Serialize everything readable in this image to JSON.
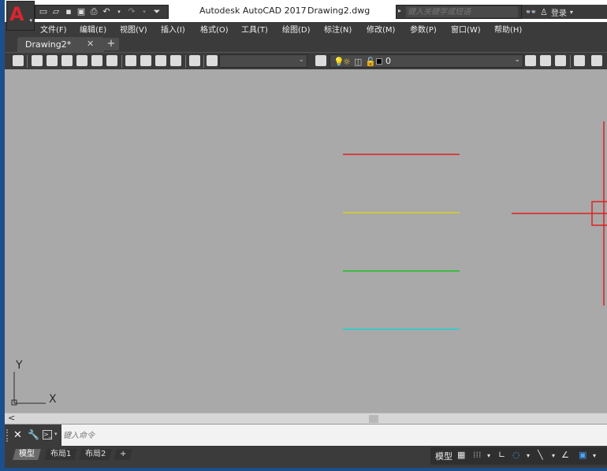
{
  "app": {
    "title": "Autodesk AutoCAD 2017",
    "filename": "Drawing2.dwg",
    "logo_letter": "A",
    "search_placeholder": "键入关键字或短语",
    "login_label": "登录"
  },
  "menu": [
    "文件(F)",
    "编辑(E)",
    "视图(V)",
    "插入(I)",
    "格式(O)",
    "工具(T)",
    "绘图(D)",
    "标注(N)",
    "修改(M)",
    "参数(P)",
    "窗口(W)",
    "帮助(H)"
  ],
  "tabs": {
    "active_doc": "Drawing2*",
    "close_glyph": "✕",
    "new_tab_glyph": "+"
  },
  "toolbar": {
    "current_layer": "0",
    "layer_color": "#000000"
  },
  "canvas": {
    "background": "#a9a9a9",
    "lines": [
      {
        "color": "#e02020"
      },
      {
        "color": "#d8d020"
      },
      {
        "color": "#20c020"
      },
      {
        "color": "#20d0d0"
      }
    ],
    "ucs": {
      "x_label": "X",
      "y_label": "Y"
    }
  },
  "scroll": {
    "left_arrow": "<"
  },
  "command": {
    "placeholder": "键入命令"
  },
  "layout_tabs": [
    "模型",
    "布局1",
    "布局2"
  ],
  "layout_add": "+",
  "status": {
    "model_label": "模型"
  }
}
